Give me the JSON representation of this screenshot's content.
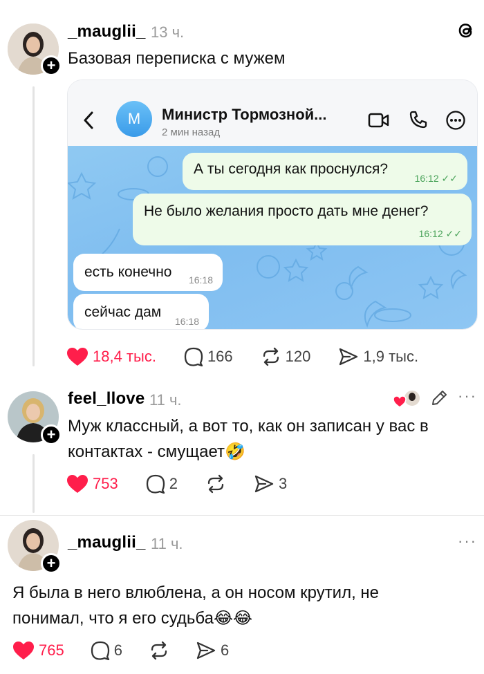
{
  "post": {
    "username": "_mauglii_",
    "time": "13 ч.",
    "text": "Базовая переписка с мужем",
    "likes": "18,4 тыс.",
    "comments": "166",
    "reposts": "120",
    "shares": "1,9 тыс."
  },
  "chat": {
    "avatar_letter": "М",
    "contact_name": "Министр Тормозной...",
    "status": "2 мин назад",
    "messages": [
      {
        "side": "out",
        "text": "А ты сегодня как проснулся?",
        "time": "16:12"
      },
      {
        "side": "out",
        "text": "Не было желания просто дать мне денег?",
        "time": "16:12"
      },
      {
        "side": "in",
        "text": "есть конечно",
        "time": "16:18"
      },
      {
        "side": "in",
        "text": "сейчас дам",
        "time": "16:18"
      }
    ]
  },
  "reply1": {
    "username": "feel_llove",
    "time": "11 ч.",
    "text": "Муж классный, а вот то, как он записан у вас в контактах - смущает🤣",
    "likes": "753",
    "comments": "2",
    "shares": "3"
  },
  "reply2": {
    "username": "_mauglii_",
    "time": "11 ч.",
    "text": "Я была в него влюблена, а он носом крутил, не понимал, что я его судьба😂😂",
    "likes": "765",
    "comments": "6",
    "shares": "6"
  },
  "colors": {
    "like_red": "#ff1e4b",
    "chat_blue": "#7fbdf0",
    "out_bubble": "#eefbe9"
  },
  "icons": [
    "threads-logo-icon",
    "heart-icon",
    "comment-icon",
    "repost-icon",
    "share-icon",
    "back-chevron-icon",
    "video-call-icon",
    "phone-icon",
    "more-icon",
    "edit-pencil-icon",
    "plus-icon"
  ]
}
